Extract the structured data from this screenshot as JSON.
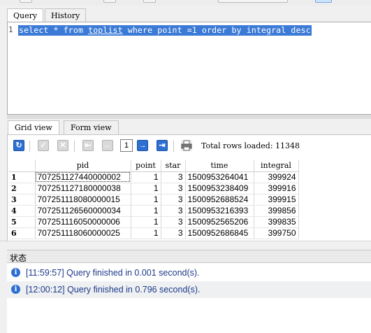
{
  "editor_tabs": [
    {
      "label": "Query"
    },
    {
      "label": "History"
    }
  ],
  "editor": {
    "line_number": "1",
    "sql_parts": [
      "select * from ",
      "toplist",
      " where point =1 order by integral desc"
    ]
  },
  "result_tabs": [
    {
      "label": "Grid view"
    },
    {
      "label": "Form view"
    }
  ],
  "toolbar": {
    "page": "1",
    "total_rows": "Total rows loaded: 11348",
    "icons": [
      "refresh-icon",
      "check-icon",
      "cancel-icon",
      "first-page-icon",
      "prev-page-icon",
      "next-page-icon",
      "last-page-icon",
      "print-icon"
    ]
  },
  "grid": {
    "columns": [
      "pid",
      "point",
      "star",
      "time",
      "integral"
    ],
    "rows": [
      {
        "n": "1",
        "pid": "707251127440000002",
        "point": "1",
        "star": "3",
        "time": "1500953264041",
        "integral": "399924"
      },
      {
        "n": "2",
        "pid": "707251127180000038",
        "point": "1",
        "star": "3",
        "time": "1500953238409",
        "integral": "399916"
      },
      {
        "n": "3",
        "pid": "707251118080000015",
        "point": "1",
        "star": "3",
        "time": "1500952688524",
        "integral": "399915"
      },
      {
        "n": "4",
        "pid": "707251126560000034",
        "point": "1",
        "star": "3",
        "time": "1500953216393",
        "integral": "399856"
      },
      {
        "n": "5",
        "pid": "707251116050000006",
        "point": "1",
        "star": "3",
        "time": "1500952565206",
        "integral": "399835"
      },
      {
        "n": "6",
        "pid": "707251118060000025",
        "point": "1",
        "star": "3",
        "time": "1500952686845",
        "integral": "399750"
      }
    ]
  },
  "status": {
    "title": "状态",
    "messages": [
      {
        "text": "[11:59:57]  Query finished in 0.001 second(s)."
      },
      {
        "text": "[12:00:12]  Query finished in 0.796 second(s)."
      }
    ]
  },
  "colors": {
    "selection": "#3b7ad6",
    "accent": "#2d6fd2",
    "log_text": "#1e3a8a"
  }
}
